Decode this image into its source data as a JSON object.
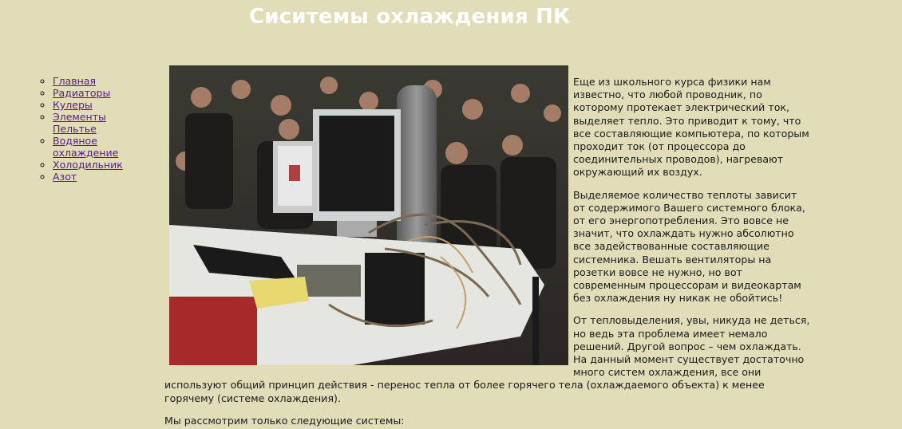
{
  "header": {
    "title": "Сиситемы охлаждения ПК"
  },
  "nav": {
    "items": [
      {
        "label": "Главная"
      },
      {
        "label": "Радиаторы"
      },
      {
        "label": "Кулеры"
      },
      {
        "label": "Элементы Пельтье"
      },
      {
        "label": "Водяное охлаждение"
      },
      {
        "label": "Холодильник"
      },
      {
        "label": "Азот"
      }
    ]
  },
  "article": {
    "photo_name": "cooling-demo-photo",
    "paragraphs": [
      "Еще из школьного курса физики нам известно, что любой проводник, по которому протекает электрический ток, выделяет тепло. Это приводит к тому, что все составляющие компьютера, по которым проходит ток (от процессора до соединительных проводов), нагревают окружающий их воздух.",
      "Выделяемое количество теплоты зависит от содержимого Вашего системного блока, от его энергопотребления. Это вовсе не значит, что охлаждать нужно абсолютно все задействованные составляющие системника. Вешать вентиляторы на розетки вовсе не нужно, но вот современным процессорам и видеокартам без охлаждения ну никак не обойтись!",
      "От тепловыделения, увы, никуда не деться, но ведь эта проблема имеет немало решений. Другой вопрос – чем охлаждать. На данный момент существует достаточно много систем охлаждения, все они используют общий принцип действия - перенос тепла от более горячего тела (охлаждаемого объекта) к менее горячему (системе охлаждения).",
      "Мы рассмотрим только следующие системы:"
    ]
  }
}
